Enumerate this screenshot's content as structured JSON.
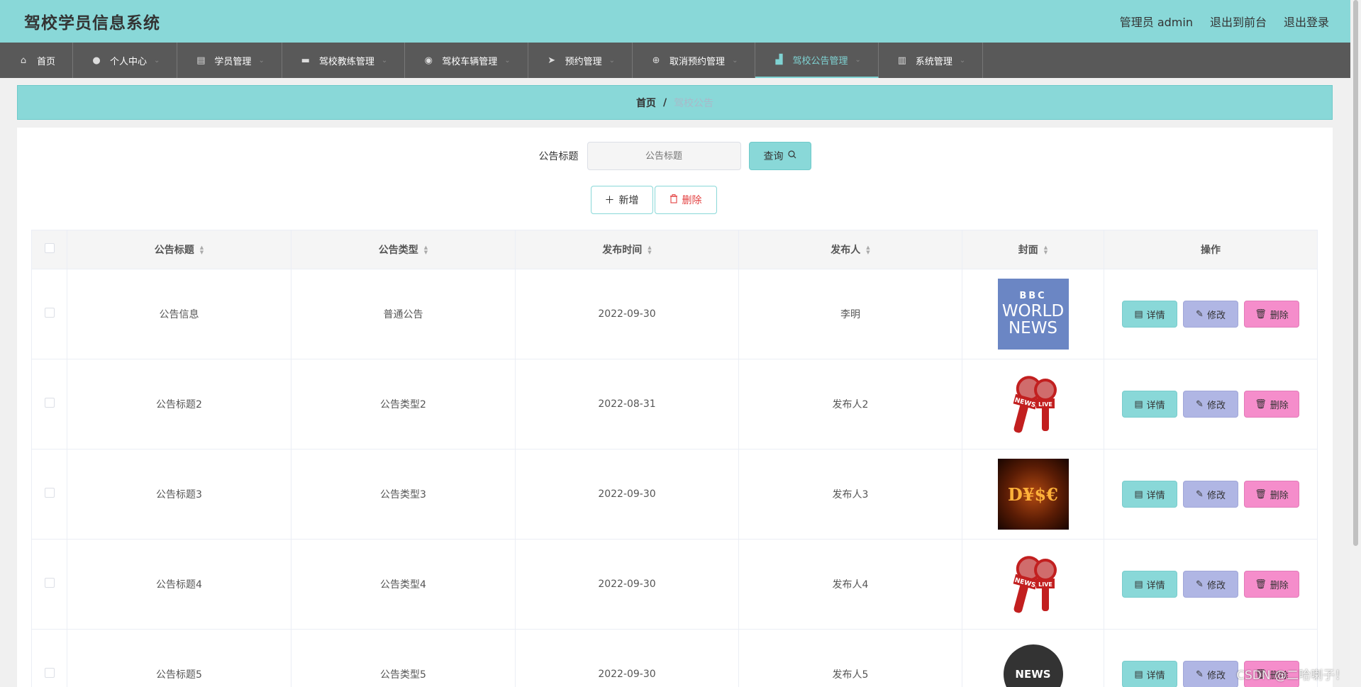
{
  "header": {
    "title": "驾校学员信息系统",
    "admin": "管理员 admin",
    "front": "退出到前台",
    "logout": "退出登录"
  },
  "nav": [
    {
      "label": "首页",
      "icon": "home-icon",
      "glyph": "⌂"
    },
    {
      "label": "个人中心",
      "icon": "user-icon",
      "glyph": "●"
    },
    {
      "label": "学员管理",
      "icon": "student-icon",
      "glyph": "▤"
    },
    {
      "label": "驾校教练管理",
      "icon": "briefcase-icon",
      "glyph": "▬"
    },
    {
      "label": "驾校车辆管理",
      "icon": "location-icon",
      "glyph": "◉"
    },
    {
      "label": "预约管理",
      "icon": "send-icon",
      "glyph": "➤"
    },
    {
      "label": "取消预约管理",
      "icon": "target-icon",
      "glyph": "⊕"
    },
    {
      "label": "驾校公告管理",
      "icon": "news-icon",
      "glyph": "▟"
    },
    {
      "label": "系统管理",
      "icon": "clipboard-icon",
      "glyph": "▥"
    }
  ],
  "breadcrumb": {
    "home": "首页",
    "sep": "/",
    "current": "驾校公告"
  },
  "search": {
    "label": "公告标题",
    "placeholder": "公告标题",
    "button": "查询"
  },
  "actions": {
    "add": "新增",
    "delete": "删除"
  },
  "table": {
    "columns": [
      "公告标题",
      "公告类型",
      "发布时间",
      "发布人",
      "封面",
      "操作"
    ],
    "rows": [
      {
        "title": "公告信息",
        "type": "普通公告",
        "date": "2022-09-30",
        "author": "李明",
        "cover": "bbc-world-news"
      },
      {
        "title": "公告标题2",
        "type": "公告类型2",
        "date": "2022-08-31",
        "author": "发布人2",
        "cover": "microphones"
      },
      {
        "title": "公告标题3",
        "type": "公告类型3",
        "date": "2022-09-30",
        "author": "发布人3",
        "cover": "money"
      },
      {
        "title": "公告标题4",
        "type": "公告类型4",
        "date": "2022-09-30",
        "author": "发布人4",
        "cover": "microphones"
      },
      {
        "title": "公告标题5",
        "type": "公告类型5",
        "date": "2022-09-30",
        "author": "发布人5",
        "cover": "news-globe"
      }
    ],
    "ops": {
      "detail": "详情",
      "edit": "修改",
      "delete": "删除"
    }
  },
  "covers": {
    "bbc": {
      "line1": "BBC",
      "line2": "WORLD",
      "line3": "NEWS"
    },
    "mic_news": "NEWS",
    "mic_live": "LIVE",
    "money": "D¥$€",
    "news": "NEWS"
  },
  "watermark": "CSDN @二哈喇子！",
  "colors": {
    "accent": "#89d8d8",
    "nav_bg": "#595959",
    "edit": "#b0b6e4",
    "delete": "#f58dcb"
  }
}
